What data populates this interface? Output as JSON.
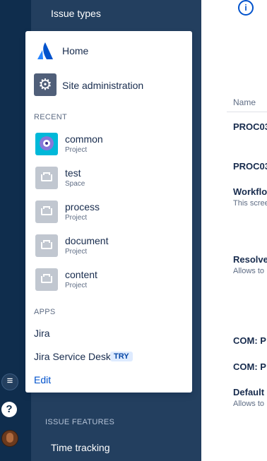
{
  "sidebar": {
    "top_item": "Issue types",
    "section_title": "ISSUE FEATURES",
    "bottom_item": "Time tracking"
  },
  "main": {
    "name_header": "Name",
    "rows": [
      {
        "title": "PROC03",
        "desc": ""
      },
      {
        "title": "PROC03",
        "desc": ""
      },
      {
        "title": "Workflo",
        "desc": "This scree"
      },
      {
        "title": "Resolve",
        "desc": "Allows to"
      },
      {
        "title": "COM: P",
        "desc": ""
      },
      {
        "title": "COM: P",
        "desc": ""
      },
      {
        "title": "Default",
        "desc": "Allows to"
      }
    ]
  },
  "dropdown": {
    "home_label": "Home",
    "site_admin_label": "Site administration",
    "recent_label": "RECENT",
    "recent": [
      {
        "name": "common",
        "type": "Project",
        "icon": "robot-project-avatar"
      },
      {
        "name": "test",
        "type": "Space",
        "icon": "tray-avatar"
      },
      {
        "name": "process",
        "type": "Project",
        "icon": "tray-avatar"
      },
      {
        "name": "document",
        "type": "Project",
        "icon": "tray-avatar"
      },
      {
        "name": "content",
        "type": "Project",
        "icon": "tray-avatar"
      }
    ],
    "apps_label": "APPS",
    "apps": [
      "Jira",
      "Jira Service Desk"
    ],
    "try_badge": "TRY",
    "edit_label": "Edit"
  },
  "colors": {
    "global_nav": "#0f2d4d",
    "side_panel": "#233f5f",
    "link": "#0052cc"
  }
}
